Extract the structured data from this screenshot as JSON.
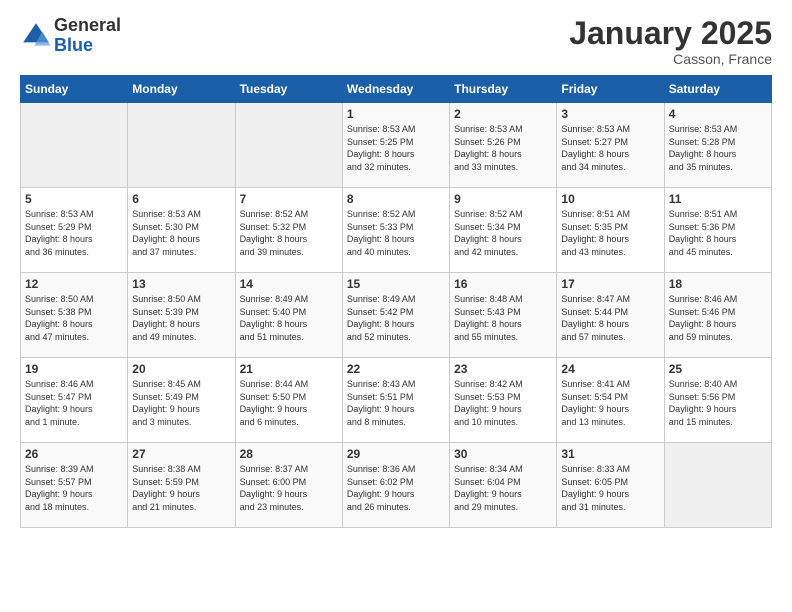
{
  "logo": {
    "general": "General",
    "blue": "Blue"
  },
  "title": "January 2025",
  "location": "Casson, France",
  "weekdays": [
    "Sunday",
    "Monday",
    "Tuesday",
    "Wednesday",
    "Thursday",
    "Friday",
    "Saturday"
  ],
  "weeks": [
    [
      {
        "day": "",
        "info": ""
      },
      {
        "day": "",
        "info": ""
      },
      {
        "day": "",
        "info": ""
      },
      {
        "day": "1",
        "info": "Sunrise: 8:53 AM\nSunset: 5:25 PM\nDaylight: 8 hours\nand 32 minutes."
      },
      {
        "day": "2",
        "info": "Sunrise: 8:53 AM\nSunset: 5:26 PM\nDaylight: 8 hours\nand 33 minutes."
      },
      {
        "day": "3",
        "info": "Sunrise: 8:53 AM\nSunset: 5:27 PM\nDaylight: 8 hours\nand 34 minutes."
      },
      {
        "day": "4",
        "info": "Sunrise: 8:53 AM\nSunset: 5:28 PM\nDaylight: 8 hours\nand 35 minutes."
      }
    ],
    [
      {
        "day": "5",
        "info": "Sunrise: 8:53 AM\nSunset: 5:29 PM\nDaylight: 8 hours\nand 36 minutes."
      },
      {
        "day": "6",
        "info": "Sunrise: 8:53 AM\nSunset: 5:30 PM\nDaylight: 8 hours\nand 37 minutes."
      },
      {
        "day": "7",
        "info": "Sunrise: 8:52 AM\nSunset: 5:32 PM\nDaylight: 8 hours\nand 39 minutes."
      },
      {
        "day": "8",
        "info": "Sunrise: 8:52 AM\nSunset: 5:33 PM\nDaylight: 8 hours\nand 40 minutes."
      },
      {
        "day": "9",
        "info": "Sunrise: 8:52 AM\nSunset: 5:34 PM\nDaylight: 8 hours\nand 42 minutes."
      },
      {
        "day": "10",
        "info": "Sunrise: 8:51 AM\nSunset: 5:35 PM\nDaylight: 8 hours\nand 43 minutes."
      },
      {
        "day": "11",
        "info": "Sunrise: 8:51 AM\nSunset: 5:36 PM\nDaylight: 8 hours\nand 45 minutes."
      }
    ],
    [
      {
        "day": "12",
        "info": "Sunrise: 8:50 AM\nSunset: 5:38 PM\nDaylight: 8 hours\nand 47 minutes."
      },
      {
        "day": "13",
        "info": "Sunrise: 8:50 AM\nSunset: 5:39 PM\nDaylight: 8 hours\nand 49 minutes."
      },
      {
        "day": "14",
        "info": "Sunrise: 8:49 AM\nSunset: 5:40 PM\nDaylight: 8 hours\nand 51 minutes."
      },
      {
        "day": "15",
        "info": "Sunrise: 8:49 AM\nSunset: 5:42 PM\nDaylight: 8 hours\nand 52 minutes."
      },
      {
        "day": "16",
        "info": "Sunrise: 8:48 AM\nSunset: 5:43 PM\nDaylight: 8 hours\nand 55 minutes."
      },
      {
        "day": "17",
        "info": "Sunrise: 8:47 AM\nSunset: 5:44 PM\nDaylight: 8 hours\nand 57 minutes."
      },
      {
        "day": "18",
        "info": "Sunrise: 8:46 AM\nSunset: 5:46 PM\nDaylight: 8 hours\nand 59 minutes."
      }
    ],
    [
      {
        "day": "19",
        "info": "Sunrise: 8:46 AM\nSunset: 5:47 PM\nDaylight: 9 hours\nand 1 minute."
      },
      {
        "day": "20",
        "info": "Sunrise: 8:45 AM\nSunset: 5:49 PM\nDaylight: 9 hours\nand 3 minutes."
      },
      {
        "day": "21",
        "info": "Sunrise: 8:44 AM\nSunset: 5:50 PM\nDaylight: 9 hours\nand 6 minutes."
      },
      {
        "day": "22",
        "info": "Sunrise: 8:43 AM\nSunset: 5:51 PM\nDaylight: 9 hours\nand 8 minutes."
      },
      {
        "day": "23",
        "info": "Sunrise: 8:42 AM\nSunset: 5:53 PM\nDaylight: 9 hours\nand 10 minutes."
      },
      {
        "day": "24",
        "info": "Sunrise: 8:41 AM\nSunset: 5:54 PM\nDaylight: 9 hours\nand 13 minutes."
      },
      {
        "day": "25",
        "info": "Sunrise: 8:40 AM\nSunset: 5:56 PM\nDaylight: 9 hours\nand 15 minutes."
      }
    ],
    [
      {
        "day": "26",
        "info": "Sunrise: 8:39 AM\nSunset: 5:57 PM\nDaylight: 9 hours\nand 18 minutes."
      },
      {
        "day": "27",
        "info": "Sunrise: 8:38 AM\nSunset: 5:59 PM\nDaylight: 9 hours\nand 21 minutes."
      },
      {
        "day": "28",
        "info": "Sunrise: 8:37 AM\nSunset: 6:00 PM\nDaylight: 9 hours\nand 23 minutes."
      },
      {
        "day": "29",
        "info": "Sunrise: 8:36 AM\nSunset: 6:02 PM\nDaylight: 9 hours\nand 26 minutes."
      },
      {
        "day": "30",
        "info": "Sunrise: 8:34 AM\nSunset: 6:04 PM\nDaylight: 9 hours\nand 29 minutes."
      },
      {
        "day": "31",
        "info": "Sunrise: 8:33 AM\nSunset: 6:05 PM\nDaylight: 9 hours\nand 31 minutes."
      },
      {
        "day": "",
        "info": ""
      }
    ]
  ]
}
